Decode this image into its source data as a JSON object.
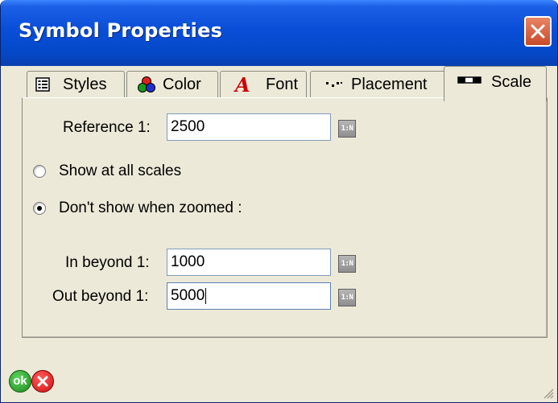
{
  "window": {
    "title": "Symbol Properties"
  },
  "tabs": [
    {
      "label": "Styles",
      "icon": "list-icon"
    },
    {
      "label": "Color",
      "icon": "color-circles-icon"
    },
    {
      "label": "Font",
      "icon": "font-a-icon"
    },
    {
      "label": "Placement",
      "icon": "placement-dots-icon"
    },
    {
      "label": "Scale",
      "icon": "scale-bar-icon",
      "active": true
    }
  ],
  "scale": {
    "reference_label": "Reference 1:",
    "reference_value": "2500",
    "radio_show_all": "Show at all scales",
    "radio_dont_show": "Don't show when zoomed :",
    "selected_radio": "dont_show",
    "in_beyond_label": "In beyond 1:",
    "in_beyond_value": "1000",
    "out_beyond_label": "Out beyond 1:",
    "out_beyond_value": "5000",
    "scale_button_label": "1:N"
  },
  "footer": {
    "ok_label": "ok",
    "cancel_label": "×"
  }
}
